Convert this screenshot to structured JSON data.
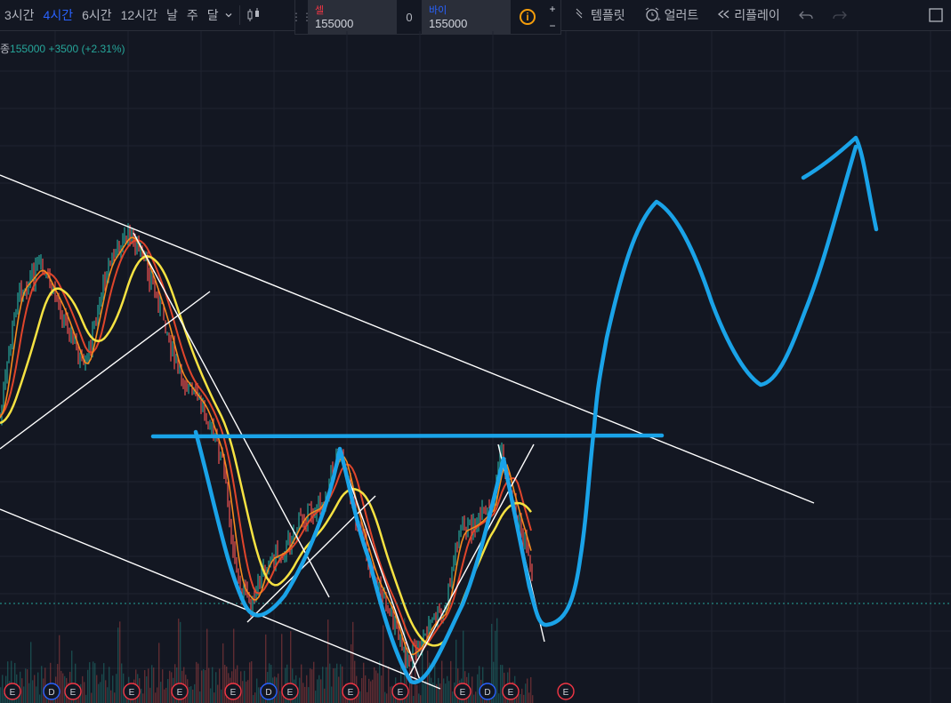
{
  "toolbar": {
    "timeframes": [
      "3시간",
      "4시간",
      "6시간",
      "12시간",
      "날",
      "주",
      "달"
    ],
    "active_timeframe": "4시간",
    "template_label": "템플릿",
    "alert_label": "얼러트",
    "replay_label": "리플레이"
  },
  "trade_panel": {
    "sell_label": "셀",
    "sell_price": "155000",
    "quantity": "0",
    "buy_label": "바이",
    "buy_price": "155000",
    "info_icon": "i",
    "plus": "+",
    "minus": "−"
  },
  "legend": {
    "close_label": "종",
    "close_value": "155000",
    "change": "+3500",
    "change_pct": "(+2.31%)"
  },
  "event_markers": [
    "E",
    "D",
    "E",
    "E",
    "E",
    "E",
    "D",
    "E",
    "E",
    "E",
    "E",
    "D",
    "E",
    "E"
  ],
  "colors": {
    "background": "#131722",
    "trend_line": "#ffffff",
    "drawing_blue": "#1aa3e8",
    "ma_yellow": "#f5e242",
    "ma_red": "#e0452b",
    "ma_orange": "#f58a1f",
    "active_tab": "#2962ff",
    "sell_red": "#f23645",
    "positive_green": "#26a69a"
  }
}
